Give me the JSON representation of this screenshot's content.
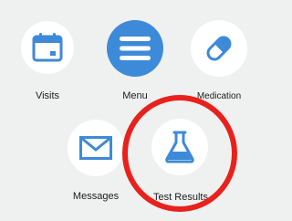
{
  "menu": {
    "items": [
      {
        "label": "Visits",
        "icon": "calendar-icon"
      },
      {
        "label": "Menu",
        "icon": "hamburger-menu-icon"
      },
      {
        "label": "Medication",
        "icon": "pill-capsule-icon"
      },
      {
        "label": "Messages",
        "icon": "envelope-icon"
      },
      {
        "label": "Test Results",
        "icon": "flask-icon"
      }
    ]
  },
  "colors": {
    "background": "#eff0f0",
    "icon_blue": "#3d8ad9",
    "highlight_circle": "#e8211c"
  }
}
